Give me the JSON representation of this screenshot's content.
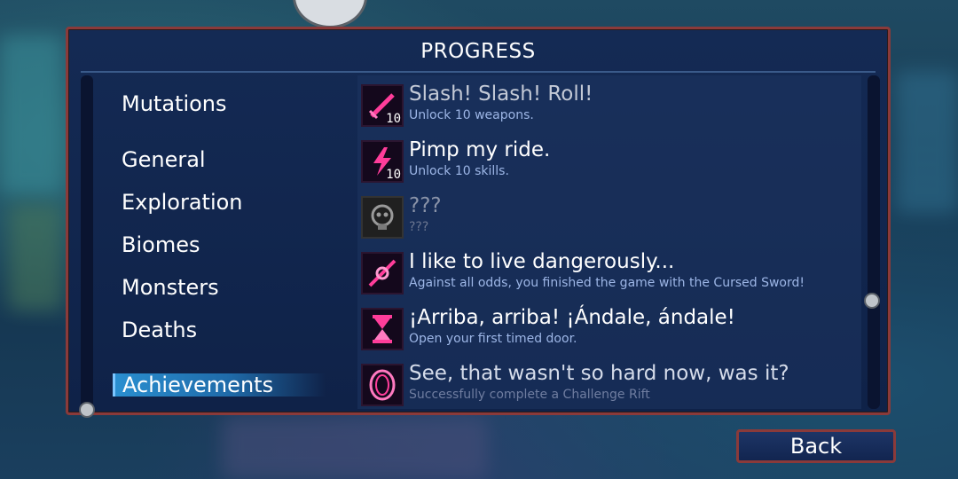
{
  "panel": {
    "title": "PROGRESS"
  },
  "categories": [
    {
      "label": "Mutations"
    },
    {
      "label": "General"
    },
    {
      "label": "Exploration"
    },
    {
      "label": "Biomes"
    },
    {
      "label": "Monsters"
    },
    {
      "label": "Deaths"
    },
    {
      "label": "Achievements",
      "selected": true
    }
  ],
  "achievements": [
    {
      "title": "Slash! Slash! Roll!",
      "desc": "Unlock 10 weapons.",
      "count": "10",
      "icon": "sword-icon"
    },
    {
      "title": "Pimp my ride.",
      "desc": "Unlock 10 skills.",
      "count": "10",
      "icon": "lightning-icon"
    },
    {
      "title": "???",
      "desc": "???",
      "icon": "locked-skull-icon"
    },
    {
      "title": "I like to live dangerously...",
      "desc": "Against all odds, you finished the game with the Cursed Sword!",
      "icon": "cursed-sword-icon"
    },
    {
      "title": "¡Arriba, arriba! ¡Ándale, ándale!",
      "desc": "Open your first timed door.",
      "icon": "hourglass-icon"
    },
    {
      "title": "See, that wasn't so hard now, was it?",
      "desc": "Successfully complete a Challenge Rift",
      "icon": "rift-icon"
    }
  ],
  "footer": {
    "back_label": "Back"
  },
  "colors": {
    "accent": "#e0197a",
    "frame": "#8a3a3a",
    "panel": "#142a54",
    "selected": "#2a8fd0"
  }
}
